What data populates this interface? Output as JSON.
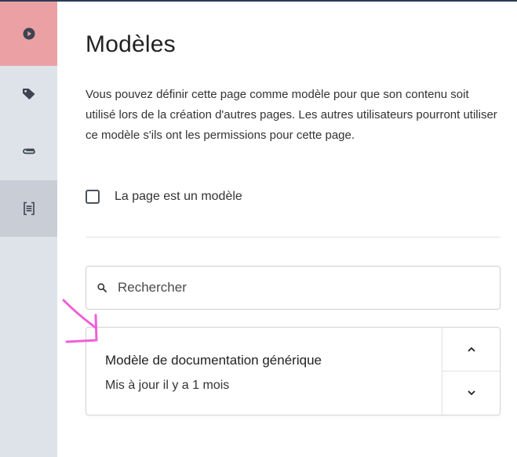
{
  "colors": {
    "sidebar_bg": "#dee3ea",
    "active_red": "#eba0a3",
    "active_grey": "#c9ced6",
    "annotation": "#ef5fd8"
  },
  "sidebar": {
    "items": [
      {
        "icon": "play-circle-icon"
      },
      {
        "icon": "tag-icon"
      },
      {
        "icon": "paperclip-icon"
      },
      {
        "icon": "template-icon"
      }
    ]
  },
  "main": {
    "title": "Modèles",
    "description": "Vous pouvez définir cette page comme modèle pour que son contenu soit utilisé lors de la création d'autres pages. Les autres utilisateurs pourront utiliser ce modèle s'ils ont les permissions pour cette page.",
    "checkbox": {
      "label": "La page est un modèle",
      "checked": false
    },
    "search": {
      "placeholder": "Rechercher",
      "value": ""
    },
    "templates": [
      {
        "name": "Modèle de documentation générique",
        "updated": "Mis à jour il y a 1 mois"
      }
    ]
  }
}
